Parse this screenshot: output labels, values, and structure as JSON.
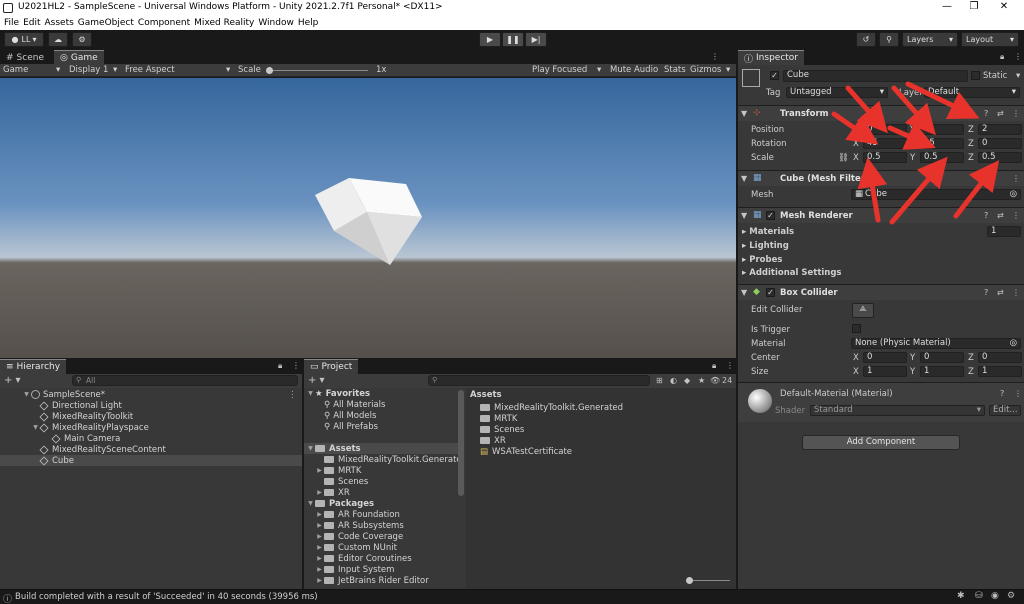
{
  "window": {
    "title": "U2021HL2 - SampleScene - Universal Windows Platform - Unity 2021.2.7f1 Personal* <DX11>",
    "menu": [
      "File",
      "Edit",
      "Assets",
      "GameObject",
      "Component",
      "Mixed Reality",
      "Window",
      "Help"
    ]
  },
  "toolbar": {
    "account": "LL",
    "layers": "Layers",
    "layout": "Layout"
  },
  "sceneTabs": {
    "scene": "Scene",
    "game": "Game"
  },
  "gameBar": {
    "mode": "Game",
    "display": "Display 1",
    "aspect": "Free Aspect",
    "scaleLabel": "Scale",
    "scaleValue": "1x",
    "playFocused": "Play Focused",
    "muteAudio": "Mute Audio",
    "stats": "Stats",
    "gizmos": "Gizmos"
  },
  "hierarchy": {
    "tab": "Hierarchy",
    "search": "All",
    "items": [
      {
        "label": "SampleScene*"
      },
      {
        "label": "Directional Light"
      },
      {
        "label": "MixedRealityToolkit"
      },
      {
        "label": "MixedRealityPlayspace"
      },
      {
        "label": "Main Camera"
      },
      {
        "label": "MixedRealitySceneContent"
      },
      {
        "label": "Cube"
      }
    ]
  },
  "project": {
    "tab": "Project",
    "hiddenCount": "24",
    "tree": [
      {
        "label": "Favorites"
      },
      {
        "label": "All Materials"
      },
      {
        "label": "All Models"
      },
      {
        "label": "All Prefabs"
      },
      {
        "label": "Assets"
      },
      {
        "label": "MixedRealityToolkit.Generate"
      },
      {
        "label": "MRTK"
      },
      {
        "label": "Scenes"
      },
      {
        "label": "XR"
      },
      {
        "label": "Packages"
      },
      {
        "label": "AR Foundation"
      },
      {
        "label": "AR Subsystems"
      },
      {
        "label": "Code Coverage"
      },
      {
        "label": "Custom NUnit"
      },
      {
        "label": "Editor Coroutines"
      },
      {
        "label": "Input System"
      },
      {
        "label": "JetBrains Rider Editor"
      }
    ],
    "contentHeader": "Assets",
    "content": [
      {
        "label": "MixedRealityToolkit.Generated"
      },
      {
        "label": "MRTK"
      },
      {
        "label": "Scenes"
      },
      {
        "label": "XR"
      },
      {
        "label": "WSATestCertificate"
      }
    ]
  },
  "inspector": {
    "tab": "Inspector",
    "objectName": "Cube",
    "static": "Static",
    "tagLabel": "Tag",
    "tagValue": "Untagged",
    "layerLabel": "Layer",
    "layerValue": "Default",
    "transform": {
      "title": "Transform",
      "position": {
        "label": "Position",
        "x": "0",
        "y": "0",
        "z": "2"
      },
      "rotation": {
        "label": "Rotation",
        "x": "45",
        "y": "45",
        "z": "0"
      },
      "scale": {
        "label": "Scale",
        "x": "0.5",
        "y": "0.5",
        "z": "0.5"
      }
    },
    "meshFilter": {
      "title": "Cube (Mesh Filter)",
      "meshLabel": "Mesh",
      "meshValue": "Cube"
    },
    "meshRenderer": {
      "title": "Mesh Renderer",
      "materials": "Materials",
      "materialsCount": "1",
      "lighting": "Lighting",
      "probes": "Probes",
      "additional": "Additional Settings"
    },
    "boxCollider": {
      "title": "Box Collider",
      "editCollider": "Edit Collider",
      "isTrigger": "Is Trigger",
      "materialLabel": "Material",
      "materialValue": "None (Physic Material)",
      "center": {
        "label": "Center",
        "x": "0",
        "y": "0",
        "z": "0"
      },
      "size": {
        "label": "Size",
        "x": "1",
        "y": "1",
        "z": "1"
      }
    },
    "material": {
      "title": "Default-Material (Material)",
      "shaderLabel": "Shader",
      "shaderValue": "Standard",
      "edit": "Edit..."
    },
    "addComponent": "Add Component"
  },
  "status": "Build completed with a result of 'Succeeded' in 40 seconds (39956 ms)",
  "colors": {
    "arrow": "#e8332c",
    "panel": "#383838",
    "header": "#3c3c3c"
  }
}
